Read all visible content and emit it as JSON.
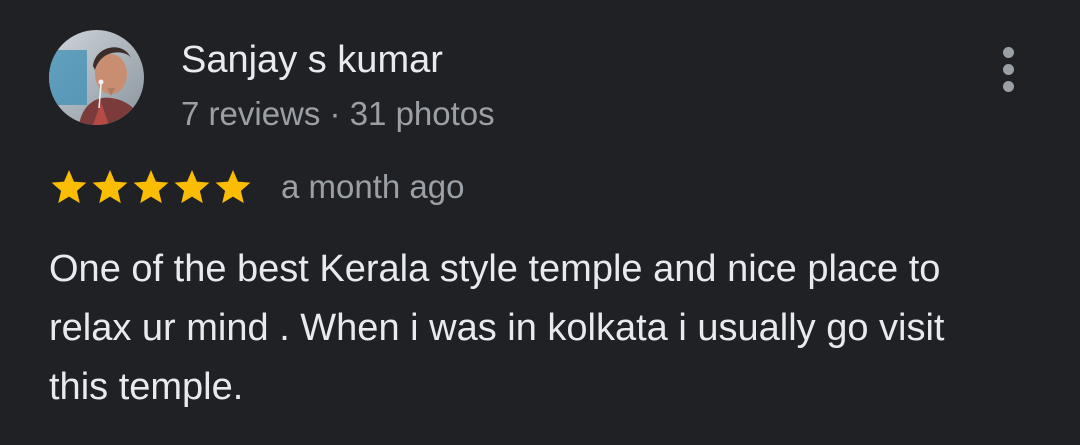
{
  "review": {
    "author": {
      "name": "Sanjay s kumar",
      "meta": "7 reviews · 31 photos",
      "avatar_icon": "user-avatar-photo"
    },
    "rating": {
      "stars": 5,
      "max_stars": 5,
      "star_color": "#fbbc04",
      "date": "a month ago"
    },
    "text": "One of the best Kerala style temple and nice place to relax ur mind . When i was in kolkata i usually go visit this temple.",
    "more_icon": "more-vert-icon"
  },
  "colors": {
    "background": "#202124",
    "primary_text": "#e8eaed",
    "secondary_text": "#9aa0a6"
  }
}
